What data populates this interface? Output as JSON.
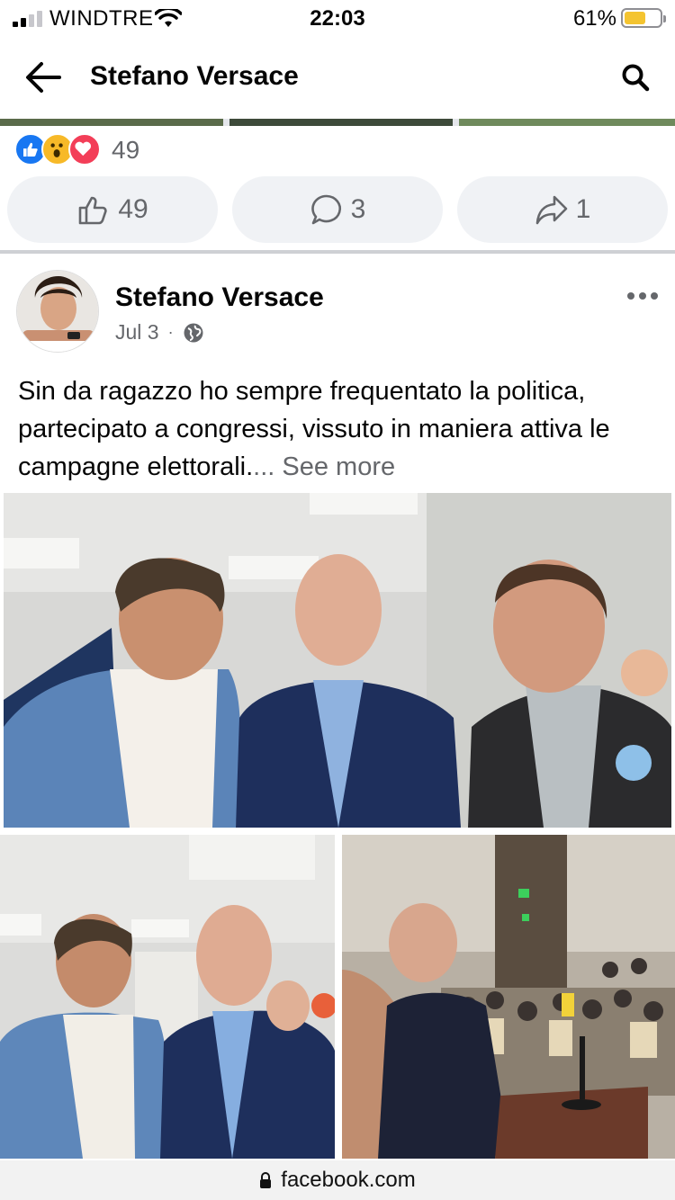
{
  "status_bar": {
    "carrier": "WINDTRE",
    "time": "22:03",
    "battery_percent": "61%",
    "battery_level": 0.61,
    "battery_color": "#f4c430"
  },
  "header": {
    "title": "Stefano Versace",
    "back_icon": "back-arrow-icon",
    "search_icon": "search-icon"
  },
  "previous_post": {
    "reaction_types": [
      "like",
      "wow",
      "love"
    ],
    "reaction_count": "49",
    "like_count": "49",
    "comment_count": "3",
    "share_count": "1"
  },
  "post": {
    "author": "Stefano Versace",
    "date": "Jul 3",
    "separator": "·",
    "privacy_icon": "globe-icon",
    "text": "Sin da ragazzo ho sempre frequentato la politica, partecipato a congressi, vissuto in maniera attiva le campagne elettorali.",
    "see_more": "... See more"
  },
  "browser": {
    "url": "facebook.com"
  },
  "colors": {
    "facebook_blue": "#1877f2",
    "wow_yellow": "#f7b928",
    "love_red": "#f33e58",
    "secondary_text": "#65676b",
    "button_bg": "#f0f2f5"
  }
}
